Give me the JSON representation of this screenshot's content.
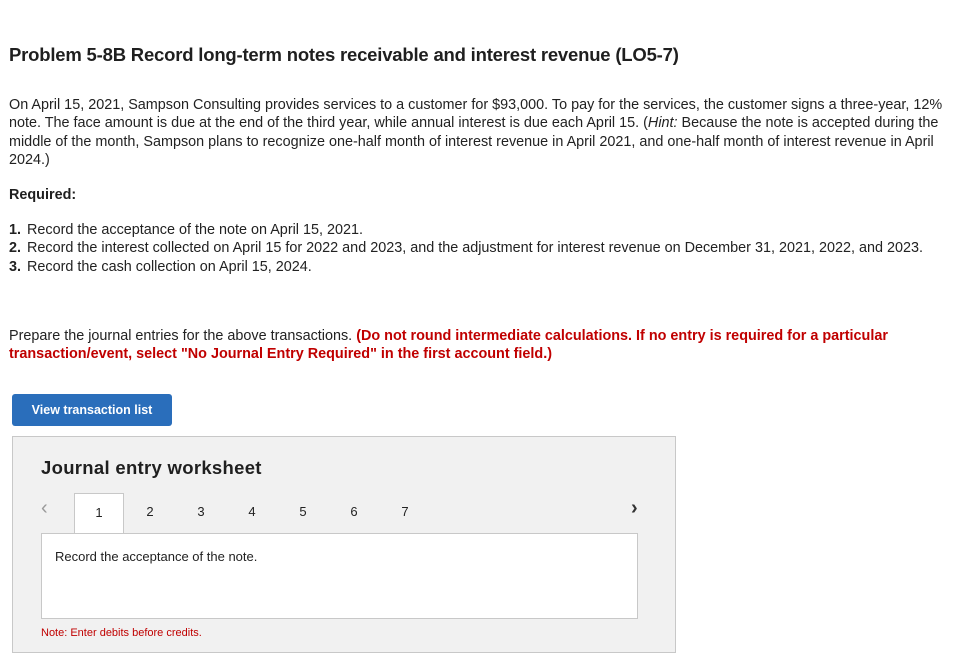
{
  "header": {
    "title": "Problem 5-8B Record long-term notes receivable and interest revenue (LO5-7)"
  },
  "intro": {
    "text_before_hint": "On April 15, 2021, Sampson Consulting provides services to a customer for $93,000. To pay for the services, the customer signs a three-year, 12% note. The face amount is  due at the end of the third year, while annual interest is due each April 15. (",
    "hint_label": "Hint:",
    "text_after_hint": " Because the note is accepted during the middle of the month, Sampson plans to recognize one-half month of interest revenue in April 2021, and one-half month of interest revenue in April 2024.)"
  },
  "required": {
    "heading": "Required:",
    "items": [
      {
        "num": "1.",
        "text": "Record the acceptance of the note on April 15, 2021."
      },
      {
        "num": "2.",
        "text": "Record the interest collected on April 15 for 2022 and 2023, and the adjustment for interest revenue on December 31, 2021, 2022, and 2023."
      },
      {
        "num": "3.",
        "text": "Record the cash collection on April 15, 2024."
      }
    ]
  },
  "instructions": {
    "plain": "Prepare the journal entries for the above transactions. ",
    "emphasis": "(Do not round intermediate calculations. If no entry is required for a particular transaction/event, select \"No Journal Entry Required\" in the first account field.)"
  },
  "buttons": {
    "view_transaction_list": "View transaction list"
  },
  "worksheet": {
    "title": "Journal entry worksheet",
    "prev_icon": "chevron-left-icon",
    "next_icon": "chevron-right-icon",
    "tabs": [
      "1",
      "2",
      "3",
      "4",
      "5",
      "6",
      "7"
    ],
    "active_tab": "1",
    "prompt": "Record the acceptance of the note.",
    "note": "Note: Enter debits before credits."
  },
  "colors": {
    "accent_blue": "#2a6ebb",
    "instruction_red": "#c00000",
    "worksheet_bg": "#f1f1f1"
  }
}
